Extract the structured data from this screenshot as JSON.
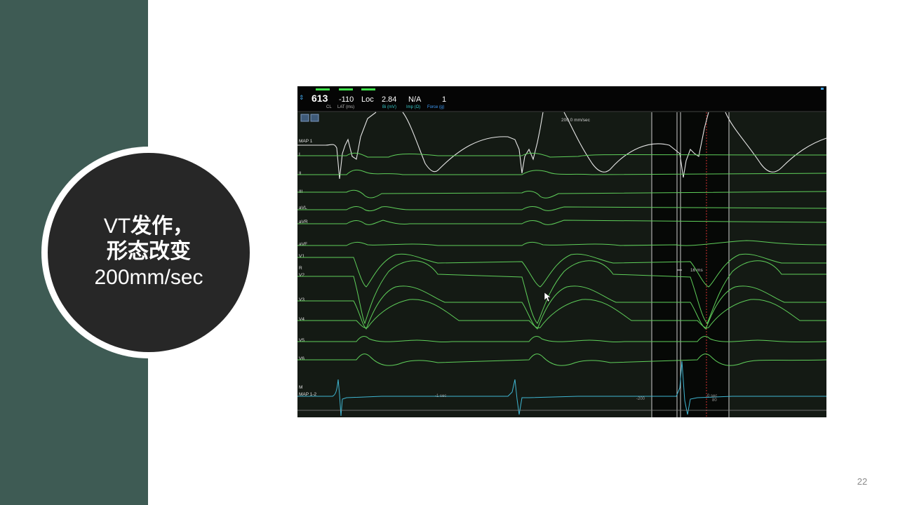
{
  "slide": {
    "title_line1_prefix": "VT",
    "title_line1_cn": "发作，",
    "title_line2": "形态改变",
    "title_line3": "200mm/sec",
    "page_number": "22"
  },
  "ecg_panel": {
    "cl_value": "613",
    "cl_label": "CL",
    "lat_value": "-110",
    "lat_label": "LAT (ms)",
    "loc_value": "Loc",
    "bi_value": "2.84",
    "bi_label": "Bi (mV)",
    "imp_value": "N/A",
    "imp_label": "Imp (Ω)",
    "force_value": "1",
    "force_label": "Force (g)",
    "speed_label": "200.0 mm/sec",
    "interval_label": "16 ms",
    "time_label_1": "-1 sec",
    "time_label_2": "-200",
    "time_label_3": "0 sec",
    "time_label_4": "80",
    "lead_labels": [
      "MAP 1",
      "I",
      "II",
      "III",
      "aVL",
      "aVR",
      "aVF",
      "V1",
      "R",
      "V2",
      "V3",
      "V4",
      "V5",
      "V6",
      "M",
      "MAP 1-2"
    ],
    "colors": {
      "background": "#141a14",
      "surface_trace": "#5fcf5a",
      "map_trace": "#e6e6e6",
      "bipolar_trace": "#3fb6d2",
      "accent_green": "#3ee04a"
    }
  }
}
